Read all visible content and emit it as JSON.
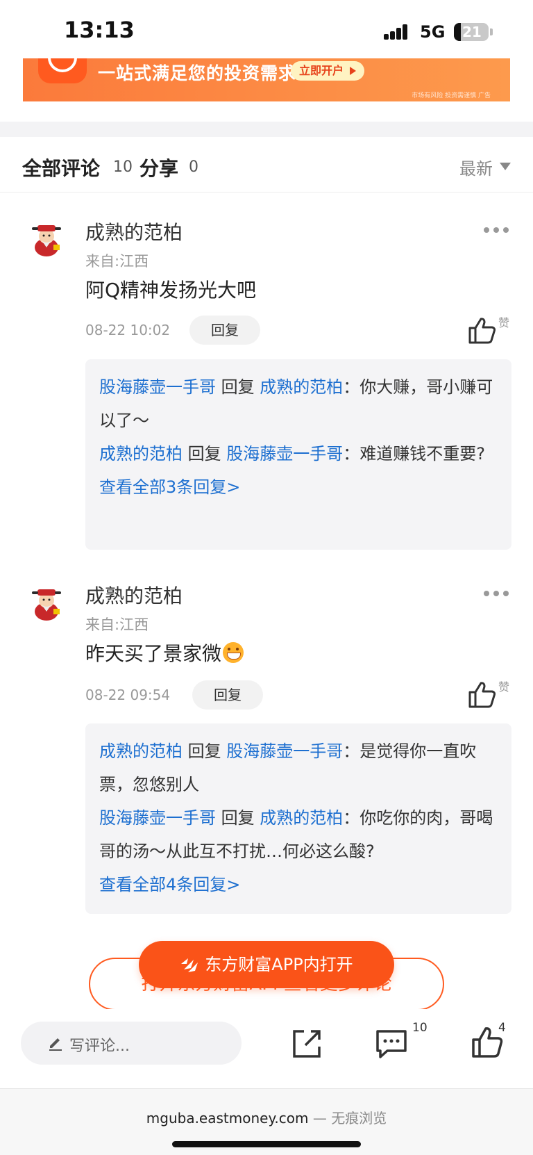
{
  "status_bar": {
    "time": "13:13",
    "network": "5G",
    "battery": "21"
  },
  "ad": {
    "headline": "一站式满足您的投资需求",
    "cta": "立即开户",
    "disclaimer": "市场有风险 投资需谨慎 广告",
    "accent_color": "#fb7a3b"
  },
  "comments_header": {
    "all_label": "全部评论",
    "all_count": "10",
    "share_label": "分享",
    "share_count": "0",
    "sort_label": "最新"
  },
  "comments": [
    {
      "author": "成熟的范柏",
      "location": "来自:江西",
      "text": "阿Q精神发扬光大吧",
      "emoji": "",
      "time": "08-22 10:02",
      "reply_label": "回复",
      "like_label": "赞",
      "replies": [
        {
          "from": "股海藤壶一手哥",
          "verb": "回复",
          "to": "成熟的范柏",
          "text": "：你大赚，哥小赚可以了～"
        },
        {
          "from": "成熟的范柏",
          "verb": "回复",
          "to": "股海藤壶一手哥",
          "text": "：难道赚钱不重要?"
        }
      ],
      "view_all": "查看全部3条回复>"
    },
    {
      "author": "成熟的范柏",
      "location": "来自:江西",
      "text": "昨天买了景家微",
      "emoji": "grinning-emoji",
      "time": "08-22 09:54",
      "reply_label": "回复",
      "like_label": "赞",
      "replies": [
        {
          "from": "成熟的范柏",
          "verb": "回复",
          "to": "股海藤壶一手哥",
          "text": "：是觉得你一直吹票，忽悠别人"
        },
        {
          "from": "股海藤壶一手哥",
          "verb": "回复",
          "to": "成熟的范柏",
          "text": "：你吃你的肉，哥喝哥的汤～从此互不打扰…何必这么酸?"
        }
      ],
      "view_all": "查看全部4条回复>"
    }
  ],
  "open_more_label": "打开东方财富APP查看更多评论",
  "open_app_label": "东方财富APP内打开",
  "action_bar": {
    "write_placeholder": "写评论...",
    "comment_count": "10",
    "like_count": "4"
  },
  "browser": {
    "url": "mguba.eastmoney.com",
    "separator": "—",
    "mode": "无痕浏览"
  },
  "colors": {
    "brand_orange": "#fa5318",
    "link_blue": "#1d6fd0"
  }
}
